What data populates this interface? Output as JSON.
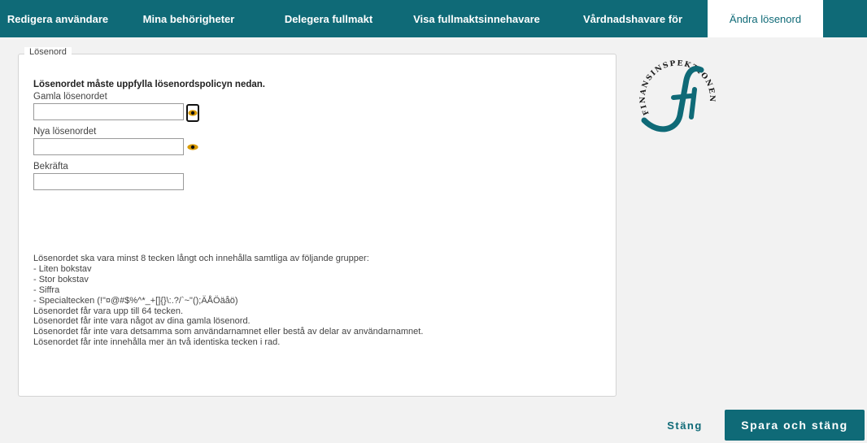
{
  "tabs": [
    {
      "label": "Redigera användare"
    },
    {
      "label": "Mina behörigheter"
    },
    {
      "label": "Delegera fullmakt"
    },
    {
      "label": "Visa fullmaktsinnehavare"
    },
    {
      "label": "Vårdnadshavare för"
    },
    {
      "label": "Ändra lösenord",
      "active": true
    }
  ],
  "panel": {
    "legend": "Lösenord",
    "policy_title": "Lösenordet måste uppfylla lösenordspolicyn nedan.",
    "fields": {
      "old_label": "Gamla lösenordet",
      "old_value": "",
      "new_label": "Nya lösenordet",
      "new_value": "",
      "confirm_label": "Bekräfta",
      "confirm_value": ""
    },
    "rules": [
      "Lösenordet ska vara minst 8 tecken långt och innehålla samtliga av följande grupper:",
      "- Liten bokstav",
      "- Stor bokstav",
      "- Siffra",
      "- Specialtecken (!\"¤@#$%^*_+[]{}\\:.?/`~\"();ÄÅÖäåö)",
      "Lösenordet får vara upp till 64 tecken.",
      "Lösenordet får inte vara något av dina gamla lösenord.",
      "Lösenordet får inte vara detsamma som användarnamnet eller bestå av delar av användarnamnet.",
      "Lösenordet får inte innehålla mer än två identiska tecken i rad."
    ]
  },
  "logo": {
    "text": "FINANSINSPEKTIONEN",
    "color": "#0f6a77"
  },
  "footer": {
    "close_label": "Stäng",
    "save_label": "Spara och stäng"
  },
  "icons": {
    "eye": "eye-icon"
  },
  "colors": {
    "brand": "#0f6a77",
    "accent_eye": "#d99a00"
  }
}
